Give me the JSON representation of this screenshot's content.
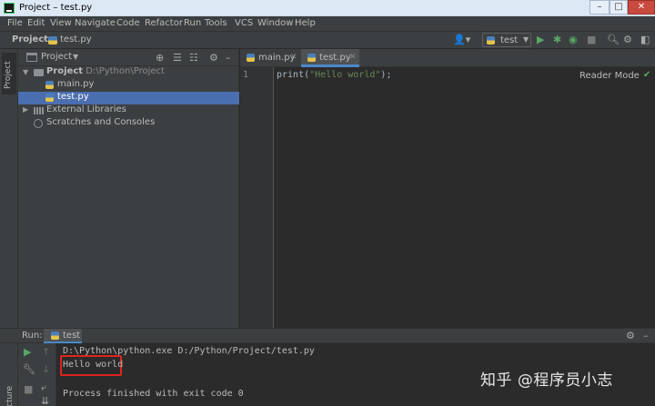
{
  "window": {
    "title": "Project – test.py",
    "buttons": [
      "–",
      "□",
      "✕"
    ]
  },
  "menu": [
    "File",
    "Edit",
    "View",
    "Navigate",
    "Code",
    "Refactor",
    "Run",
    "Tools",
    "VCS",
    "Window",
    "Help"
  ],
  "navbar": {
    "project": "Project",
    "file": "test.py",
    "run_config": "test"
  },
  "left_strip": {
    "project_tab": "Project"
  },
  "project_panel": {
    "title": "Project",
    "tree": {
      "root_name": "Project",
      "root_path": "D:\\Python\\Project",
      "file1": "main.py",
      "file2": "test.py",
      "external": "External Libraries",
      "scratches": "Scratches and Consoles"
    }
  },
  "editor": {
    "tabs": [
      "main.py",
      "test.py"
    ],
    "active_tab": "test.py",
    "line_number": "1",
    "code": {
      "fn": "print",
      "open": "(",
      "str": "\"Hello world\"",
      "close": ");"
    },
    "reader_mode": "Reader Mode"
  },
  "run_panel": {
    "label": "Run:",
    "tab": "test",
    "side_label": "cture",
    "console": {
      "command": "D:\\Python\\python.exe D:/Python/Project/test.py",
      "output": "Hello world",
      "exit": "Process finished with exit code 0"
    }
  },
  "watermark": "知乎 @程序员小志",
  "colors": {
    "selection": "#4b6eaf",
    "accent": "#4a88c7",
    "string": "#6a8759",
    "run_green": "#5fa75f",
    "highlight_box": "#e0231d"
  },
  "icons": {
    "navbar": [
      "user-icon",
      "run-icon",
      "debug-icon",
      "coverage-icon",
      "stop-icon",
      "search-icon",
      "settings-icon"
    ],
    "panel_header": [
      "locate-icon",
      "expand-all-icon",
      "collapse-all-icon",
      "gear-icon",
      "minimize-icon"
    ],
    "run_tools": [
      "rerun-icon",
      "up-icon",
      "wrench-icon",
      "down-icon",
      "stop-icon",
      "soft-wrap-icon",
      "pin-icon",
      "scroll-end-icon"
    ]
  }
}
